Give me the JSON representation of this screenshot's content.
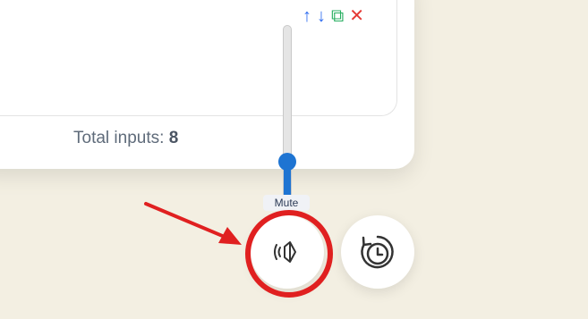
{
  "card": {
    "actions": {
      "up": "↑",
      "down": "↓",
      "duplicate": "⧉",
      "delete": "✕"
    },
    "total_label": "Total inputs:",
    "total_value": "8"
  },
  "volume": {
    "tooltip": "Mute",
    "level": 0.2
  },
  "buttons": {
    "mute_icon": "speaker-mute-icon",
    "history_icon": "history-clock-icon"
  },
  "colors": {
    "accent": "#1e74d2",
    "highlight": "#e02020",
    "background": "#f3efe2"
  }
}
